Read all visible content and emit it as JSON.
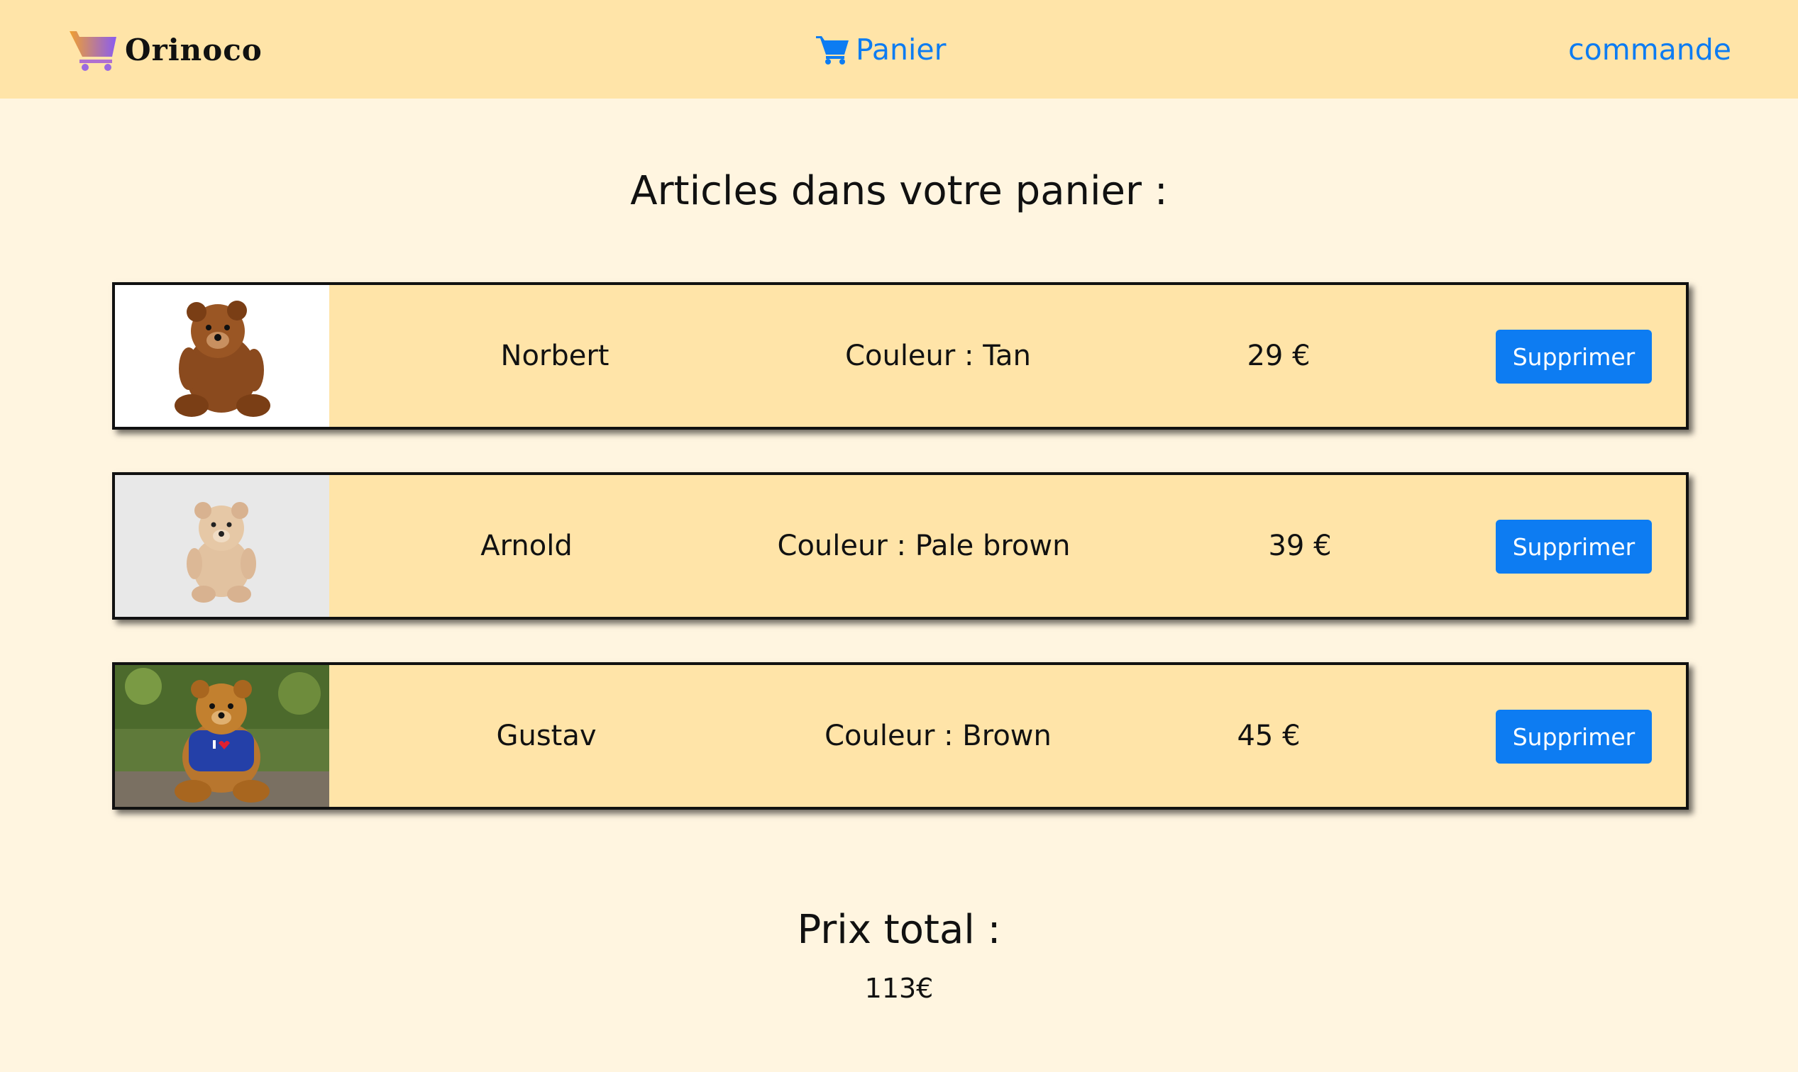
{
  "header": {
    "brand_name": "Orinoco",
    "cart_link": "Panier",
    "order_link": "commande"
  },
  "page_title": "Articles dans votre panier :",
  "cart_items": [
    {
      "name": "Norbert",
      "color": "Couleur : Tan",
      "price": "29 €",
      "delete_label": "Supprimer",
      "image": "teddy-bear-brown-photo"
    },
    {
      "name": "Arnold",
      "color": "Couleur : Pale brown",
      "price": "39 €",
      "delete_label": "Supprimer",
      "image": "teddy-bear-beige-photo"
    },
    {
      "name": "Gustav",
      "color": "Couleur : Brown",
      "price": "45 €",
      "delete_label": "Supprimer",
      "image": "teddy-bear-shirt-photo"
    }
  ],
  "total": {
    "label": "Prix total :",
    "value": "113€"
  },
  "colors": {
    "header_bg": "#ffe4a8",
    "page_bg": "#fff5e0",
    "accent": "#0d7cf2"
  }
}
